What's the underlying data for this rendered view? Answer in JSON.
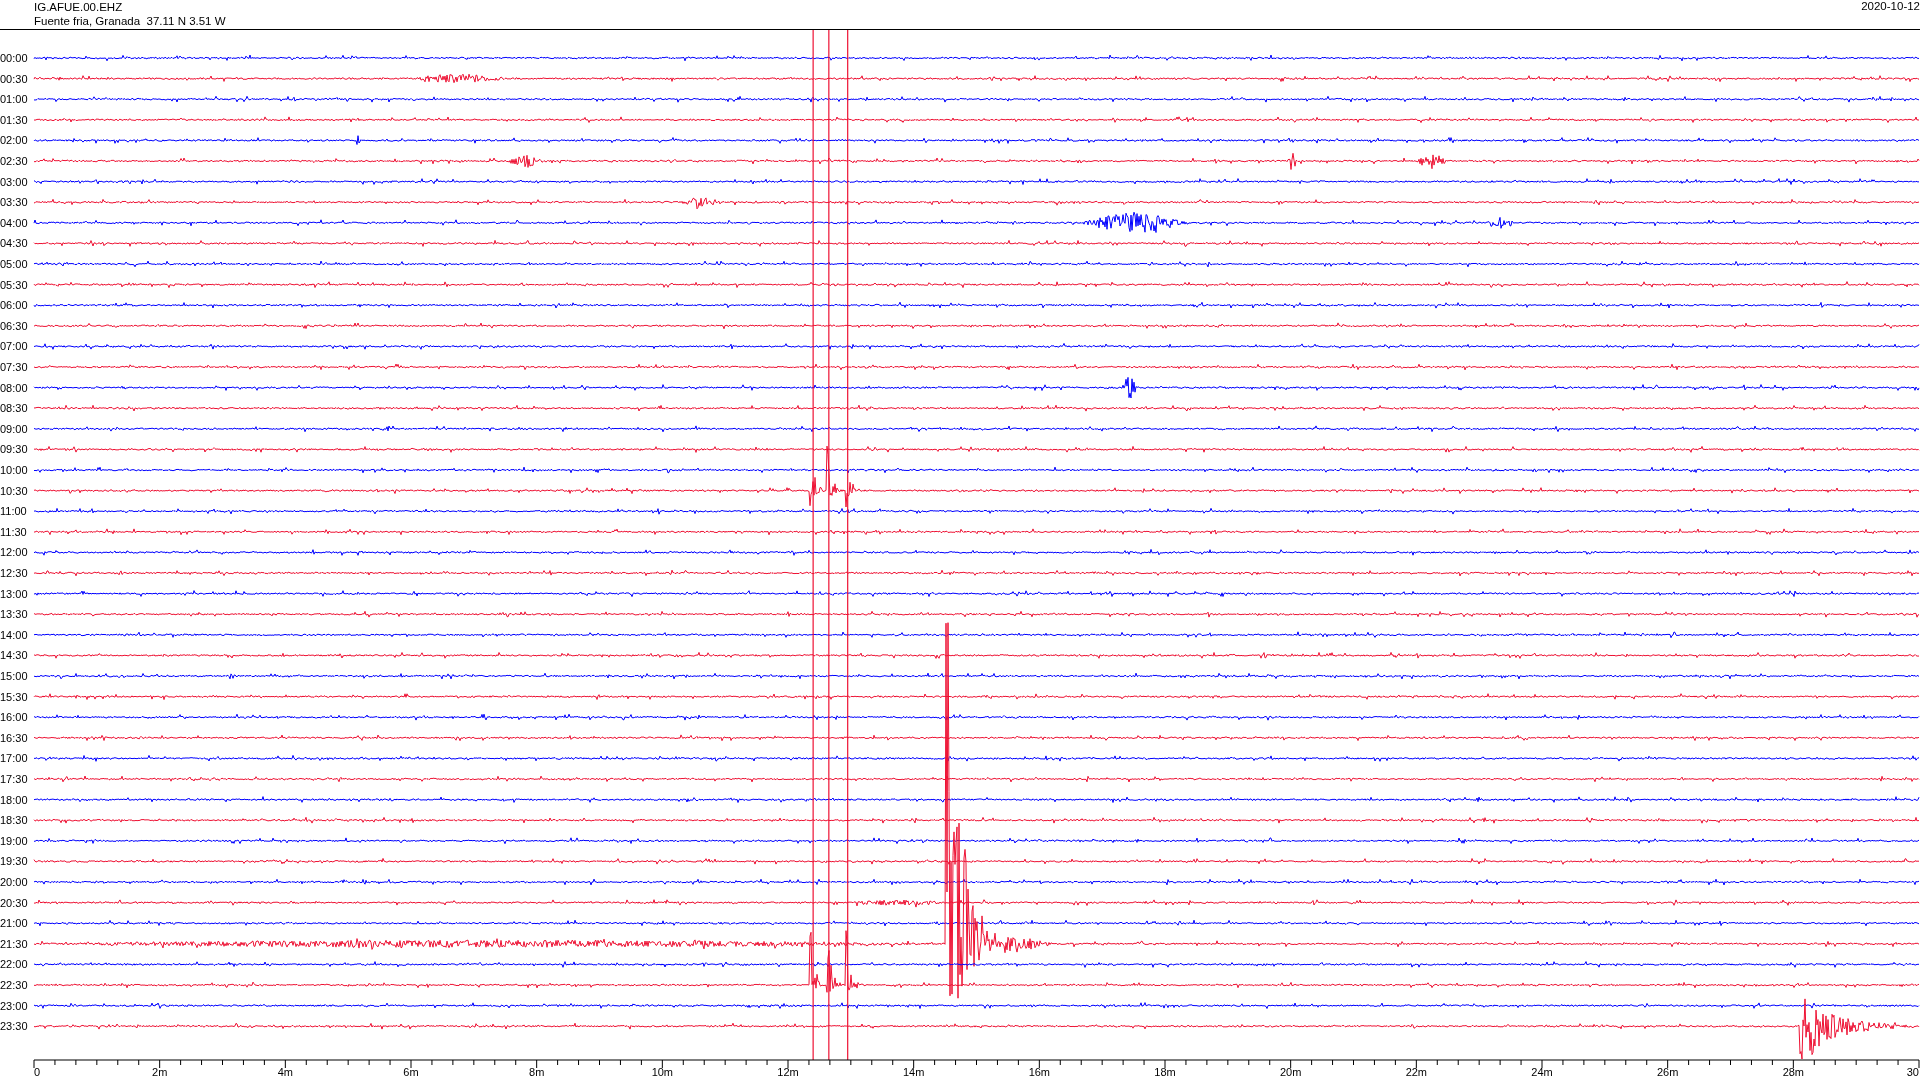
{
  "header": {
    "station": "IG.AFUE.00.EHZ",
    "location": "Fuente fria, Granada  37.11 N 3.51 W",
    "date": "2020-10-12"
  },
  "traces": [
    {
      "label": "00:00",
      "color": "#0000ff"
    },
    {
      "label": "00:30",
      "color": "#ee1133"
    },
    {
      "label": "01:00",
      "color": "#0000ff"
    },
    {
      "label": "01:30",
      "color": "#ee1133"
    },
    {
      "label": "02:00",
      "color": "#0000ff"
    },
    {
      "label": "02:30",
      "color": "#ee1133"
    },
    {
      "label": "03:00",
      "color": "#0000ff"
    },
    {
      "label": "03:30",
      "color": "#ee1133"
    },
    {
      "label": "04:00",
      "color": "#0000ff"
    },
    {
      "label": "04:30",
      "color": "#ee1133"
    },
    {
      "label": "05:00",
      "color": "#0000ff"
    },
    {
      "label": "05:30",
      "color": "#ee1133"
    },
    {
      "label": "06:00",
      "color": "#0000ff"
    },
    {
      "label": "06:30",
      "color": "#ee1133"
    },
    {
      "label": "07:00",
      "color": "#0000ff"
    },
    {
      "label": "07:30",
      "color": "#ee1133"
    },
    {
      "label": "08:00",
      "color": "#0000ff"
    },
    {
      "label": "08:30",
      "color": "#ee1133"
    },
    {
      "label": "09:00",
      "color": "#0000ff"
    },
    {
      "label": "09:30",
      "color": "#ee1133"
    },
    {
      "label": "10:00",
      "color": "#0000ff"
    },
    {
      "label": "10:30",
      "color": "#ee1133"
    },
    {
      "label": "11:00",
      "color": "#0000ff"
    },
    {
      "label": "11:30",
      "color": "#ee1133"
    },
    {
      "label": "12:00",
      "color": "#0000ff"
    },
    {
      "label": "12:30",
      "color": "#ee1133"
    },
    {
      "label": "13:00",
      "color": "#0000ff"
    },
    {
      "label": "13:30",
      "color": "#ee1133"
    },
    {
      "label": "14:00",
      "color": "#0000ff"
    },
    {
      "label": "14:30",
      "color": "#ee1133"
    },
    {
      "label": "15:00",
      "color": "#0000ff"
    },
    {
      "label": "15:30",
      "color": "#ee1133"
    },
    {
      "label": "16:00",
      "color": "#0000ff"
    },
    {
      "label": "16:30",
      "color": "#ee1133"
    },
    {
      "label": "17:00",
      "color": "#0000ff"
    },
    {
      "label": "17:30",
      "color": "#ee1133"
    },
    {
      "label": "18:00",
      "color": "#0000ff"
    },
    {
      "label": "18:30",
      "color": "#ee1133"
    },
    {
      "label": "19:00",
      "color": "#0000ff"
    },
    {
      "label": "19:30",
      "color": "#ee1133"
    },
    {
      "label": "20:00",
      "color": "#0000ff"
    },
    {
      "label": "20:30",
      "color": "#ee1133"
    },
    {
      "label": "21:00",
      "color": "#0000ff"
    },
    {
      "label": "21:30",
      "color": "#ee1133"
    },
    {
      "label": "22:00",
      "color": "#0000ff"
    },
    {
      "label": "22:30",
      "color": "#ee1133"
    },
    {
      "label": "23:00",
      "color": "#0000ff"
    },
    {
      "label": "23:30",
      "color": "#ee1133"
    }
  ],
  "x_axis": {
    "ticks": [
      "0",
      "2m",
      "4m",
      "6m",
      "8m",
      "10m",
      "12m",
      "14m",
      "16m",
      "18m",
      "20m",
      "22m",
      "24m",
      "26m",
      "28m",
      "30"
    ]
  }
}
